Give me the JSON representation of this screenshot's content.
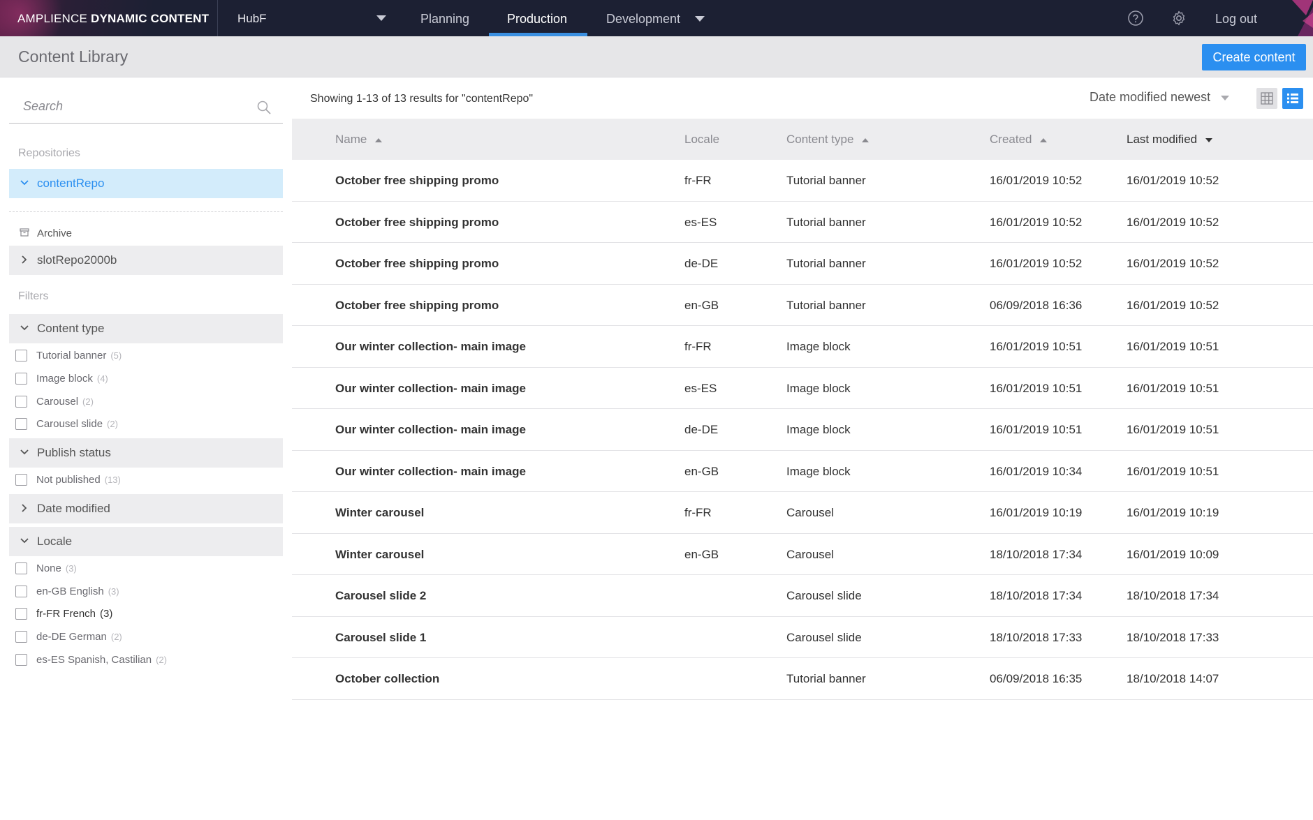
{
  "topbar": {
    "brand_light": "AMPLIENCE",
    "brand_bold": "DYNAMIC CONTENT",
    "hub": "HubF",
    "nav": [
      {
        "label": "Planning"
      },
      {
        "label": "Production"
      },
      {
        "label": "Development"
      }
    ],
    "active_nav": "Production",
    "help_icon": "help-icon",
    "settings_icon": "gear-icon",
    "logout": "Log out",
    "bg_color": "#1c2033",
    "accent": "#3a8fe0"
  },
  "subheader": {
    "title": "Content Library",
    "create_button": "Create content",
    "button_color": "#2b8ff0"
  },
  "sidebar": {
    "search_placeholder": "Search",
    "repositories_label": "Repositories",
    "repositories": [
      {
        "label": "contentRepo",
        "expanded": true
      },
      {
        "label": "slotRepo2000b",
        "expanded": false
      }
    ],
    "archive_label": "Archive",
    "filters_label": "Filters",
    "filters": [
      {
        "title": "Content type",
        "expanded": true,
        "options": [
          {
            "label": "Tutorial banner",
            "count": "(5)"
          },
          {
            "label": "Image block",
            "count": "(4)"
          },
          {
            "label": "Carousel",
            "count": "(2)"
          },
          {
            "label": "Carousel slide",
            "count": "(2)"
          }
        ]
      },
      {
        "title": "Publish status",
        "expanded": true,
        "options": [
          {
            "label": "Not published",
            "count": "(13)"
          }
        ]
      },
      {
        "title": "Date modified",
        "expanded": false,
        "options": []
      },
      {
        "title": "Locale",
        "expanded": true,
        "options": [
          {
            "label": "None",
            "count": "(3)"
          },
          {
            "label": "en-GB English",
            "count": "(3)"
          },
          {
            "label": "fr-FR French",
            "count": "(3)"
          },
          {
            "label": "de-DE German",
            "count": "(2)"
          },
          {
            "label": "es-ES Spanish, Castilian",
            "count": "(2)"
          }
        ]
      }
    ]
  },
  "main": {
    "results_text": "Showing 1-13 of 13 results for \"contentRepo\"",
    "sort_label": "Date modified newest",
    "grid_view_icon": "grid-view-icon",
    "list_view_icon": "list-view-icon",
    "columns": [
      "Name",
      "Locale",
      "Content type",
      "Created",
      "Last modified"
    ],
    "rows": [
      {
        "name": "October free shipping promo",
        "locale": "fr-FR",
        "type": "Tutorial banner",
        "created": "16/01/2019 10:52",
        "modified": "16/01/2019 10:52"
      },
      {
        "name": "October free shipping promo",
        "locale": "es-ES",
        "type": "Tutorial banner",
        "created": "16/01/2019 10:52",
        "modified": "16/01/2019 10:52"
      },
      {
        "name": "October free shipping promo",
        "locale": "de-DE",
        "type": "Tutorial banner",
        "created": "16/01/2019 10:52",
        "modified": "16/01/2019 10:52"
      },
      {
        "name": "October free shipping promo",
        "locale": "en-GB",
        "type": "Tutorial banner",
        "created": "06/09/2018 16:36",
        "modified": "16/01/2019 10:52"
      },
      {
        "name": "Our winter collection- main image",
        "locale": "fr-FR",
        "type": "Image block",
        "created": "16/01/2019 10:51",
        "modified": "16/01/2019 10:51"
      },
      {
        "name": "Our winter collection- main image",
        "locale": "es-ES",
        "type": "Image block",
        "created": "16/01/2019 10:51",
        "modified": "16/01/2019 10:51"
      },
      {
        "name": "Our winter collection- main image",
        "locale": "de-DE",
        "type": "Image block",
        "created": "16/01/2019 10:51",
        "modified": "16/01/2019 10:51"
      },
      {
        "name": "Our winter collection- main image",
        "locale": "en-GB",
        "type": "Image block",
        "created": "16/01/2019 10:34",
        "modified": "16/01/2019 10:51"
      },
      {
        "name": "Winter carousel",
        "locale": "fr-FR",
        "type": "Carousel",
        "created": "16/01/2019 10:19",
        "modified": "16/01/2019 10:19"
      },
      {
        "name": "Winter carousel",
        "locale": "en-GB",
        "type": "Carousel",
        "created": "18/10/2018 17:34",
        "modified": "16/01/2019 10:09"
      },
      {
        "name": "Carousel slide 2",
        "locale": "",
        "type": "Carousel slide",
        "created": "18/10/2018 17:34",
        "modified": "18/10/2018 17:34"
      },
      {
        "name": "Carousel slide 1",
        "locale": "",
        "type": "Carousel slide",
        "created": "18/10/2018 17:33",
        "modified": "18/10/2018 17:33"
      },
      {
        "name": "October collection",
        "locale": "",
        "type": "Tutorial banner",
        "created": "06/09/2018 16:35",
        "modified": "18/10/2018 14:07"
      }
    ]
  }
}
